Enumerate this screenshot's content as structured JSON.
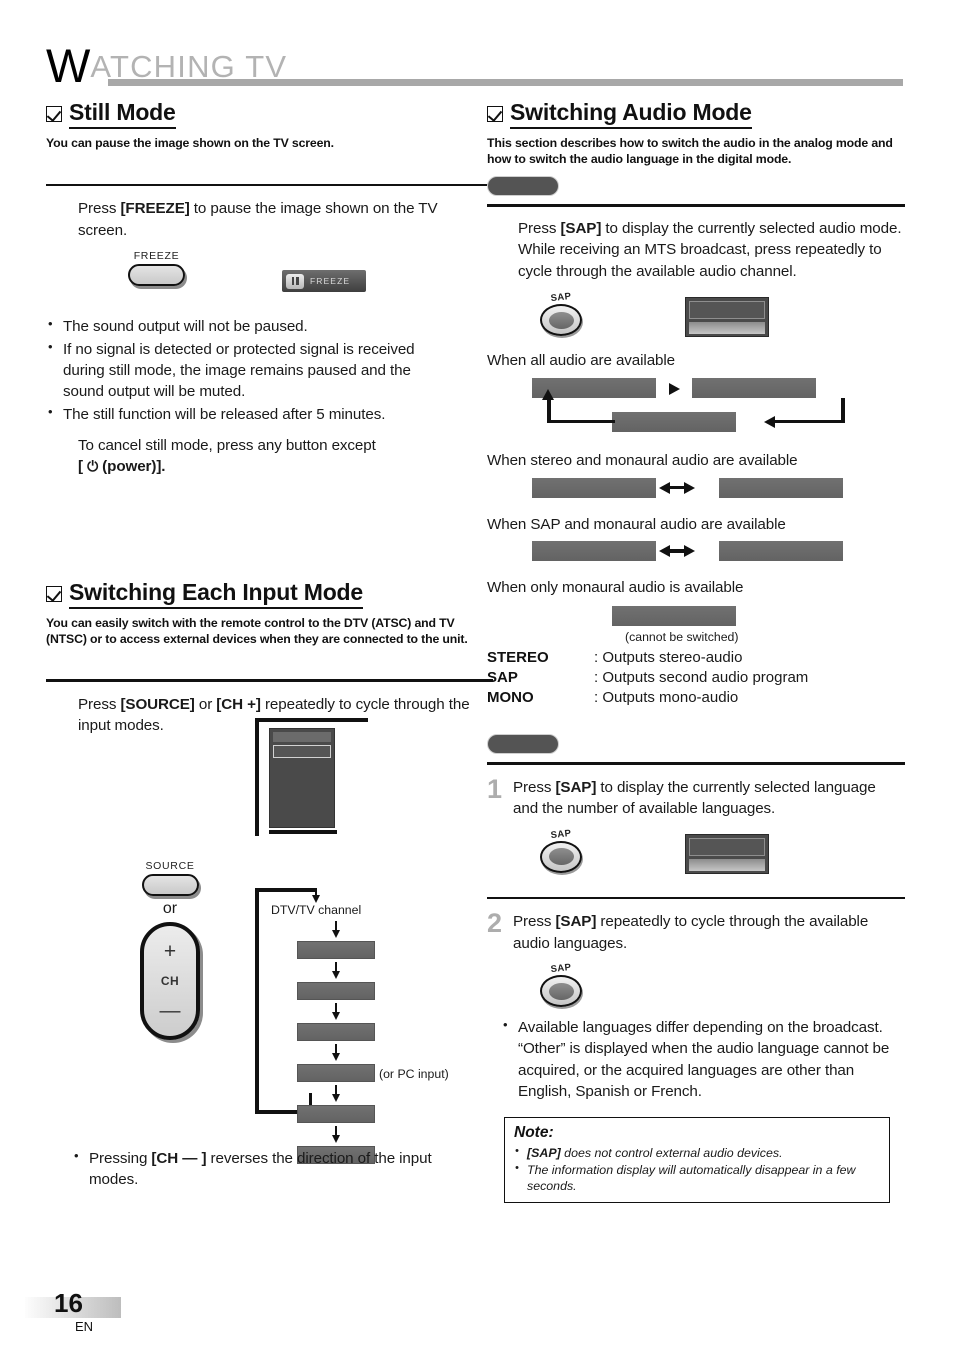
{
  "header": {
    "title_cap": "W",
    "title_rest": "ATCHING  TV"
  },
  "left_column": {
    "still_mode": {
      "heading": "Still Mode",
      "subheading": "You can pause the image shown on the TV screen.",
      "instruction_pre": "Press ",
      "instruction_key": "[FREEZE]",
      "instruction_post": " to pause the image shown on the TV screen.",
      "remote_button_label": "FREEZE",
      "osd_label": "FREEZE",
      "bullets": [
        "The sound output will not be paused.",
        "If no signal is detected or protected signal is received during still mode, the image remains paused and the sound output will be muted.",
        "The still function will be released after 5 minutes."
      ],
      "cancel_line1": "To cancel still mode, press any button except",
      "cancel_line2_pre": "[ ",
      "cancel_line2_post": " (power)]."
    },
    "input_mode": {
      "heading": "Switching Each Input Mode",
      "subheading": "You can easily switch with the remote control to the DTV (ATSC) and TV (NTSC) or to access external devices when they are connected to the unit.",
      "instruction_pre": "Press ",
      "instruction_key1": "[SOURCE]",
      "instruction_mid": " or ",
      "instruction_key2": "[CH +]",
      "instruction_post": " repeatedly to cycle through the input modes.",
      "source_button_label": "SOURCE",
      "or_label": "or",
      "ch_rocker": {
        "plus": "+",
        "label": "CH",
        "minus": "—"
      },
      "flow_first_label": "DTV/TV channel",
      "flow_pc_note": "(or PC input)",
      "flow_item_count": 5,
      "bullet_pre": "Pressing ",
      "bullet_key": "[CH — ]",
      "bullet_post": " reverses the direction of the input modes."
    }
  },
  "right_column": {
    "audio_mode": {
      "heading": "Switching Audio Mode",
      "subheading": "This section describes how to switch the audio in the analog mode and how to switch the audio language in the digital mode.",
      "analog_instruction_pre": "Press ",
      "analog_instruction_key": "[SAP]",
      "analog_instruction_post": " to display the currently selected audio mode. While receiving an MTS broadcast, press repeatedly to cycle through the available audio channel.",
      "sap_button_label": "SAP",
      "cycle_caption_all": "When all audio are available",
      "cycle_caption_stereo_mono": "When stereo and monaural audio are available",
      "cycle_caption_sap_mono": "When SAP and monaural audio are available",
      "cycle_caption_mono_only": "When only monaural audio is available",
      "cannot_switch_note": "(cannot be switched)",
      "definitions": [
        {
          "term": "STEREO",
          "desc": ": Outputs stereo-audio"
        },
        {
          "term": "SAP",
          "desc": ": Outputs second audio program"
        },
        {
          "term": "MONO",
          "desc": ": Outputs mono-audio"
        }
      ],
      "steps": [
        {
          "number": "1",
          "pre": "Press ",
          "key": "[SAP]",
          "post": " to display the currently selected language and the number of available languages.",
          "button_label": "SAP"
        },
        {
          "number": "2",
          "pre": "Press ",
          "key": "[SAP]",
          "post": " repeatedly to cycle through the available audio languages.",
          "button_label": "SAP"
        }
      ],
      "bullet": "Available languages differ depending on the broadcast. “Other” is displayed when the audio language cannot be acquired, or the acquired languages are other than English, Spanish or French.",
      "note": {
        "title": "Note:",
        "items": [
          {
            "key": "[SAP]",
            "text": " does not control external audio devices."
          },
          {
            "key": "",
            "text": "The information display will automatically disappear in a few seconds."
          }
        ]
      }
    }
  },
  "footer": {
    "page_number": "16",
    "language": "EN"
  }
}
